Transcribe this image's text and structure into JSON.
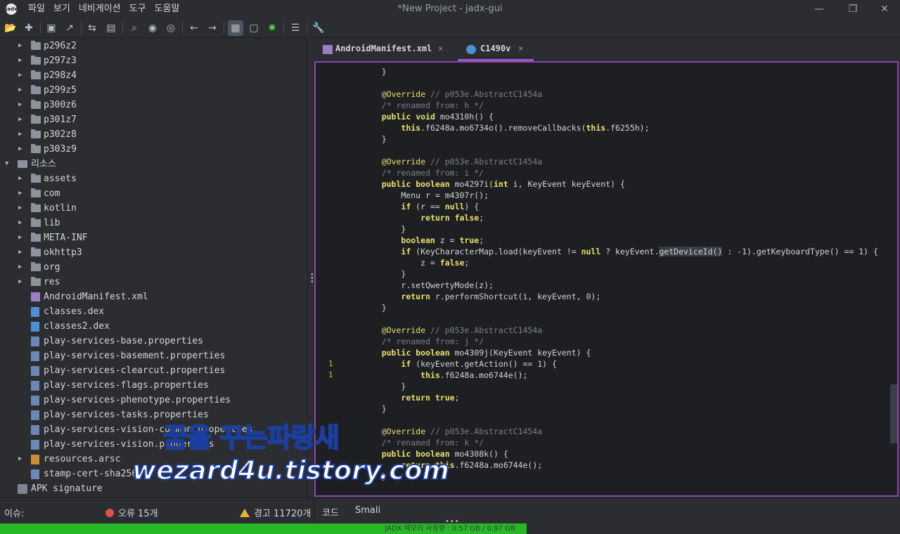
{
  "window": {
    "title": "*New Project - jadx-gui",
    "logo_text": "jadx",
    "controls": [
      "—",
      "❐",
      "✕"
    ]
  },
  "menu": [
    "파일",
    "보기",
    "네비게이션",
    "도구",
    "도움말"
  ],
  "toolbar": {
    "icons": [
      "open-icon",
      "add-icon",
      "save-icon",
      "export-icon",
      "sync-icon",
      "flatten-icon",
      "search-icon",
      "find-class-icon",
      "find-usage-icon",
      "back-icon",
      "forward-icon",
      "quark-icon",
      "deobf-icon",
      "debug-icon",
      "log-icon",
      "settings-icon"
    ]
  },
  "tree": {
    "packages": [
      "p296z2",
      "p297z3",
      "p298z4",
      "p299z5",
      "p300z6",
      "p301z7",
      "p302z8",
      "p303z9"
    ],
    "resources_label": "리소스",
    "resource_folders": [
      "assets",
      "com",
      "kotlin",
      "lib",
      "META-INF",
      "okhttp3",
      "org",
      "res"
    ],
    "resource_files": [
      {
        "name": "AndroidManifest.xml",
        "type": "mf"
      },
      {
        "name": "classes.dex",
        "type": "dex"
      },
      {
        "name": "classes2.dex",
        "type": "dex"
      },
      {
        "name": "play-services-base.properties",
        "type": "prop"
      },
      {
        "name": "play-services-basement.properties",
        "type": "prop"
      },
      {
        "name": "play-services-clearcut.properties",
        "type": "prop"
      },
      {
        "name": "play-services-flags.properties",
        "type": "prop"
      },
      {
        "name": "play-services-phenotype.properties",
        "type": "prop"
      },
      {
        "name": "play-services-tasks.properties",
        "type": "prop"
      },
      {
        "name": "play-services-vision-common.properties",
        "type": "prop"
      },
      {
        "name": "play-services-vision.properties",
        "type": "prop"
      },
      {
        "name": "resources.arsc",
        "type": "arsc"
      },
      {
        "name": "stamp-cert-sha256",
        "type": "prop"
      }
    ],
    "apk_signature": "APK signature"
  },
  "tabs": [
    {
      "label": "AndroidManifest.xml",
      "active": false,
      "close": "×"
    },
    {
      "label": "C1490v",
      "active": true,
      "close": "×"
    }
  ],
  "code": {
    "lines": [
      {
        "n": "",
        "t": "    }"
      },
      {
        "n": "",
        "t": ""
      },
      {
        "n": "",
        "t": "    @Override // p053e.AbstractC1454a"
      },
      {
        "n": "",
        "t": "    /* renamed from: h */"
      },
      {
        "n": "",
        "t": "    public void mo4310h() {"
      },
      {
        "n": "",
        "t": "        this.f6248a.mo6734o().removeCallbacks(this.f6255h);"
      },
      {
        "n": "",
        "t": "    }"
      },
      {
        "n": "",
        "t": ""
      },
      {
        "n": "",
        "t": "    @Override // p053e.AbstractC1454a"
      },
      {
        "n": "",
        "t": "    /* renamed from: i */"
      },
      {
        "n": "",
        "t": "    public boolean mo4297i(int i, KeyEvent keyEvent) {"
      },
      {
        "n": "",
        "t": "        Menu r = m4307r();"
      },
      {
        "n": "",
        "t": "        if (r == null) {"
      },
      {
        "n": "",
        "t": "            return false;"
      },
      {
        "n": "",
        "t": "        }"
      },
      {
        "n": "",
        "t": "        boolean z = true;"
      },
      {
        "n": "",
        "t": "        if (KeyCharacterMap.load(keyEvent != null ? keyEvent.getDeviceId() : -1).getKeyboardType() == 1) {"
      },
      {
        "n": "",
        "t": "            z = false;"
      },
      {
        "n": "",
        "t": "        }"
      },
      {
        "n": "",
        "t": "        r.setQwertyMode(z);"
      },
      {
        "n": "",
        "t": "        return r.performShortcut(i, keyEvent, 0);"
      },
      {
        "n": "",
        "t": "    }"
      },
      {
        "n": "",
        "t": ""
      },
      {
        "n": "",
        "t": "    @Override // p053e.AbstractC1454a"
      },
      {
        "n": "",
        "t": "    /* renamed from: j */"
      },
      {
        "n": "",
        "t": "    public boolean mo4309j(KeyEvent keyEvent) {"
      },
      {
        "n": "1",
        "t": "        if (keyEvent.getAction() == 1) {"
      },
      {
        "n": "1",
        "t": "            this.f6248a.mo6744e();"
      },
      {
        "n": "",
        "t": "        }"
      },
      {
        "n": "",
        "t": "        return true;"
      },
      {
        "n": "",
        "t": "    }"
      },
      {
        "n": "",
        "t": ""
      },
      {
        "n": "",
        "t": "    @Override // p053e.AbstractC1454a"
      },
      {
        "n": "",
        "t": "    /* renamed from: k */"
      },
      {
        "n": "",
        "t": "    public boolean mo4308k() {"
      },
      {
        "n": "",
        "t": "        return this.f6248a.mo6744e();"
      },
      {
        "n": "",
        "t": "    }"
      }
    ]
  },
  "watermark": {
    "line1": "꿈을 꾸는파랑새",
    "line2": "wezard4u.tistory.com"
  },
  "status": {
    "issues_label": "이슈:",
    "errors": "오류 15개",
    "warnings": "경고 11720개",
    "bottom_tabs": [
      "코드",
      "Smali"
    ],
    "dots": "•••"
  },
  "memory": {
    "text": "JADX 메모리 사용량 : 0.57 GB / 0.97 GB",
    "used_fraction": 0.585
  }
}
